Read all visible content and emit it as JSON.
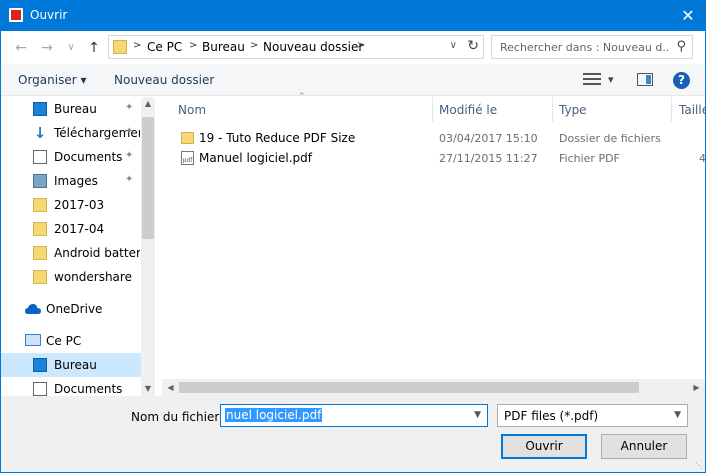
{
  "window": {
    "title": "Ouvrir",
    "close_glyph": "✕"
  },
  "nav": {
    "back_glyph": "←",
    "forward_glyph": "→",
    "recent_glyph": "∨",
    "up_glyph": "↑"
  },
  "address": {
    "crumbs": [
      "Ce PC",
      "Bureau",
      "Nouveau dossier"
    ],
    "separator": ">",
    "refresh_glyph": "↻",
    "dropdown_glyph": "∨"
  },
  "search": {
    "placeholder": "Rechercher dans : Nouveau d...",
    "icon": "search-icon"
  },
  "toolbar": {
    "organize_label": "Organiser ▾",
    "new_folder_label": "Nouveau dossier",
    "view_dropdown_glyph": "▾",
    "help_glyph": "?"
  },
  "sidebar": {
    "items": [
      {
        "label": "Bureau",
        "icon": "desktop-icon",
        "pinned": true
      },
      {
        "label": "Téléchargements",
        "icon": "download-icon",
        "pinned": true
      },
      {
        "label": "Documents",
        "icon": "documents-icon",
        "pinned": true
      },
      {
        "label": "Images",
        "icon": "pictures-icon",
        "pinned": true
      },
      {
        "label": "2017-03",
        "icon": "folder-icon",
        "pinned": false
      },
      {
        "label": "2017-04",
        "icon": "folder-icon",
        "pinned": false
      },
      {
        "label": "Android battery",
        "icon": "folder-icon",
        "pinned": false
      },
      {
        "label": "wondershare",
        "icon": "folder-icon",
        "pinned": false
      },
      {
        "label": "OneDrive",
        "icon": "onedrive-icon",
        "pinned": false
      },
      {
        "label": "Ce PC",
        "icon": "computer-icon",
        "pinned": false
      },
      {
        "label": "Bureau",
        "icon": "desktop-icon",
        "pinned": false,
        "selected": true
      },
      {
        "label": "Documents",
        "icon": "documents-icon",
        "pinned": false
      }
    ],
    "pin_glyph": "📌"
  },
  "columns": {
    "name": "Nom",
    "modified": "Modifié le",
    "type": "Type",
    "size": "Taille"
  },
  "files": [
    {
      "name": "19 - Tuto Reduce PDF Size",
      "modified": "03/04/2017 15:10",
      "type": "Dossier de fichiers",
      "size": "",
      "icon": "folder-icon"
    },
    {
      "name": "Manuel logiciel.pdf",
      "modified": "27/11/2015 11:27",
      "type": "Fichier PDF",
      "size": "4",
      "icon": "pdf-file-icon"
    }
  ],
  "footer": {
    "filename_label": "Nom du fichier :",
    "filename_value": "nuel logiciel.pdf",
    "filetype_value": "PDF files (*.pdf)",
    "open_label": "Ouvrir",
    "cancel_label": "Annuler"
  },
  "colors": {
    "titlebar": "#0078d7",
    "selection": "#cce8ff",
    "text_selection": "#3399ff"
  }
}
